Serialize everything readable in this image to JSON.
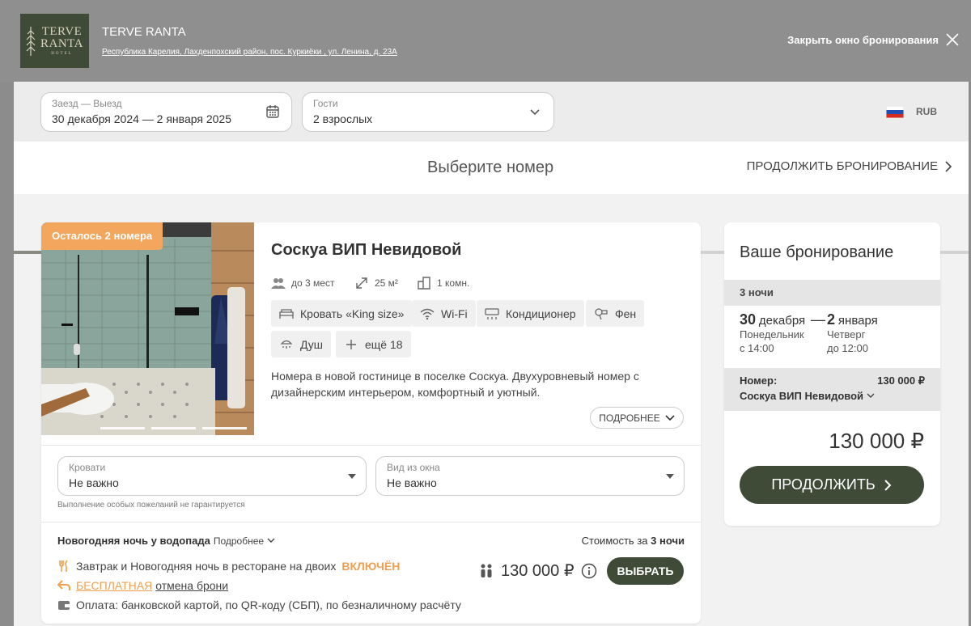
{
  "header": {
    "logo": {
      "line1": "TERVE",
      "line2": "RANTA",
      "line3": "HOTEL"
    },
    "hotel_name": "TERVE RANTA",
    "address": "Республика Карелия, Лахденпохский район, пос. Куркиёки , ул. Ленина, д. 23А",
    "close_label": "Закрыть окно бронирования"
  },
  "search": {
    "dates_label": "Заезд — Выезд",
    "dates_value": "30 декабря 2024 — 2 января 2025",
    "guests_label": "Гости",
    "guests_value": "2 взрослых",
    "currency": "RUB"
  },
  "steps": {
    "title": "Выберите номер",
    "continue_label": "ПРОДОЛЖИТЬ БРОНИРОВАНИЕ",
    "progress": 0.25
  },
  "room": {
    "badge": "Осталось 2 номера",
    "title": "Соскуа ВИП Невидовой",
    "guests": "до 3 мест",
    "area": "25 м²",
    "rooms": "1 комн.",
    "amenities": [
      "Кровать «King size»",
      "Wi-Fi",
      "Кондиционер",
      "Фен",
      "Душ",
      "ещё 18"
    ],
    "description": "Номера в новой гостинице в поселке Соскуа. Двухуровневый номер с дизайнерским интерьером, комфортный и уютный.",
    "more_label": "ПОДРОБНЕЕ",
    "beds_label": "Кровати",
    "beds_value": "Не важно",
    "view_label": "Вид из окна",
    "view_value": "Не важно",
    "wishes_note": "Выполнение особых пожеланий не гарантируется"
  },
  "rate": {
    "name": "Новогодняя ночь у водопада",
    "more": "Подробнее",
    "cost_label": "Стоимость за",
    "cost_nights": "3 ночи",
    "feature1": "Завтрак и Новогодняя ночь в ресторане на двоих",
    "feature1_tag": "ВКЛЮЧЁН",
    "feature2_tag": "БЕСПЛАТНАЯ",
    "feature2": "отмена брони",
    "feature3": "Оплата: банковской картой, по QR-коду (СБП), по безналичному расчёту",
    "price": "130 000 ₽",
    "select_label": "ВЫБРАТЬ"
  },
  "summary": {
    "title": "Ваше бронирование",
    "nights": "3 ночи",
    "checkin_day": "30",
    "checkin_month": "декабря",
    "checkin_weekday": "Понедельник",
    "checkin_time": "с 14:00",
    "checkout_day": "2",
    "checkout_month": "января",
    "checkout_weekday": "Четверг",
    "checkout_time": "до 12:00",
    "room_label": "Номер:",
    "room_price": "130 000 ₽",
    "room_name": "Соскуа ВИП Невидовой",
    "total": "130 000 ₽",
    "continue_label": "ПРОДОЛЖИТЬ"
  },
  "colors": {
    "brand_dark": "#3f4a37",
    "accent_orange": "#f2a65e",
    "overlay_gray": "#8f8f8f"
  }
}
